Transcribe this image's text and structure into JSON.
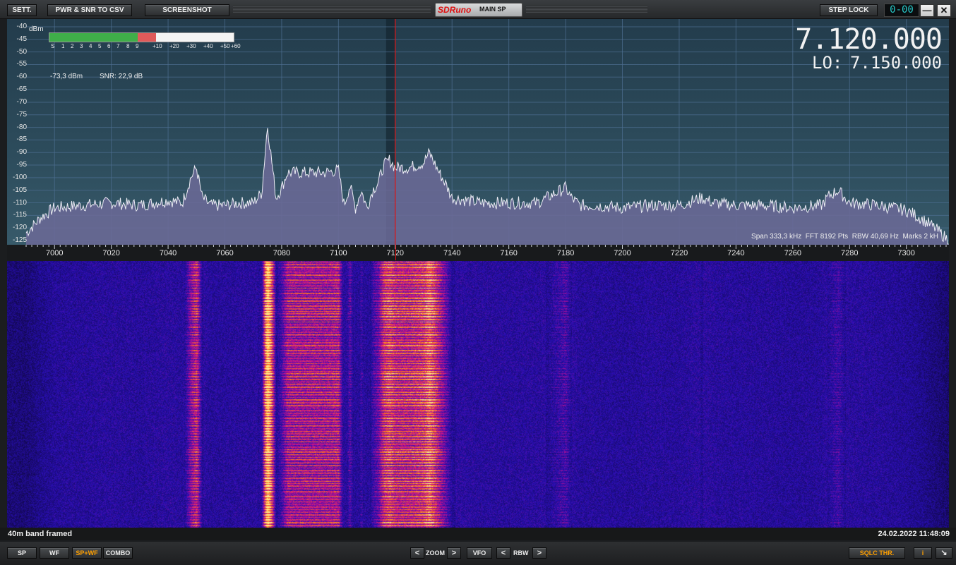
{
  "toolbar": {
    "sett_label": "SETT.",
    "pwr_snr_label": "PWR & SNR TO CSV",
    "screenshot_label": "SCREENSHOT",
    "step_lock_label": "STEP LOCK",
    "counter": "0-00"
  },
  "logo": {
    "brand": "SDRuno",
    "title": "MAIN SP"
  },
  "meter": {
    "unit": "dBm",
    "scale": [
      "S",
      "1",
      "2",
      "3",
      "4",
      "5",
      "6",
      "7",
      "8",
      "9",
      "+10",
      "+20",
      "+30",
      "+40",
      "+50",
      "+60"
    ],
    "reading_dbm": "-73,3 dBm",
    "snr": "SNR: 22,9 dB",
    "level_fraction": 0.58
  },
  "frequency": {
    "main": "7.120.000",
    "lo_label": "LO:",
    "lo": "7.150.000"
  },
  "spectrum_info": {
    "span": "Span 333,3 kHz",
    "fft": "FFT 8192 Pts",
    "rbw": "RBW 40,69 Hz",
    "marks": "Marks 2 kH"
  },
  "status": {
    "left": "40m band framed",
    "right": "24.02.2022 11:48:09"
  },
  "bottom": {
    "sp": "SP",
    "wf": "WF",
    "spwf": "SP+WF",
    "combo": "COMBO",
    "prev": "<",
    "next": ">",
    "zoom": "ZOOM",
    "vfo": "VFO",
    "rbw": "RBW",
    "sqlc": "SQLC THR.",
    "info": "i",
    "resize": "↘"
  },
  "colors": {
    "accent_orange": "#ffa000",
    "marker_red": "#e01010",
    "digits": "#27c7c7"
  },
  "chart_data": {
    "type": "area",
    "ylabel": "dBm",
    "ylim": [
      -125,
      -40
    ],
    "y_ticks": [
      -40,
      -45,
      -50,
      -55,
      -60,
      -65,
      -70,
      -75,
      -80,
      -85,
      -90,
      -95,
      -100,
      -105,
      -110,
      -115,
      -120,
      -125
    ],
    "xlim": [
      6990,
      7315
    ],
    "x_ticks": [
      7000,
      7020,
      7040,
      7060,
      7080,
      7100,
      7120,
      7140,
      7160,
      7180,
      7200,
      7220,
      7240,
      7260,
      7280,
      7300
    ],
    "tuned_khz": 7120,
    "grid": true,
    "x": [
      6990,
      6995,
      7000,
      7010,
      7020,
      7030,
      7040,
      7045,
      7048,
      7050,
      7052,
      7055,
      7060,
      7065,
      7070,
      7073,
      7075,
      7078,
      7080,
      7082,
      7090,
      7095,
      7100,
      7102,
      7104,
      7106,
      7108,
      7110,
      7112,
      7114,
      7116,
      7118,
      7120,
      7125,
      7130,
      7132,
      7135,
      7138,
      7140,
      7150,
      7160,
      7170,
      7180,
      7182,
      7185,
      7190,
      7200,
      7210,
      7220,
      7228,
      7232,
      7240,
      7250,
      7260,
      7270,
      7273,
      7276,
      7280,
      7290,
      7300,
      7305,
      7310,
      7315
    ],
    "y": [
      -122,
      -116,
      -112,
      -111,
      -110,
      -111,
      -109,
      -110,
      -100,
      -96,
      -108,
      -111,
      -111,
      -110,
      -110,
      -106,
      -79,
      -108,
      -104,
      -98,
      -98,
      -98,
      -97,
      -111,
      -103,
      -112,
      -105,
      -112,
      -105,
      -102,
      -95,
      -93,
      -96,
      -96,
      -94,
      -90,
      -97,
      -103,
      -108,
      -110,
      -110,
      -110,
      -104,
      -108,
      -111,
      -111,
      -112,
      -111,
      -111,
      -108,
      -110,
      -111,
      -111,
      -112,
      -111,
      -107,
      -105,
      -110,
      -111,
      -113,
      -116,
      -120,
      -125
    ]
  }
}
